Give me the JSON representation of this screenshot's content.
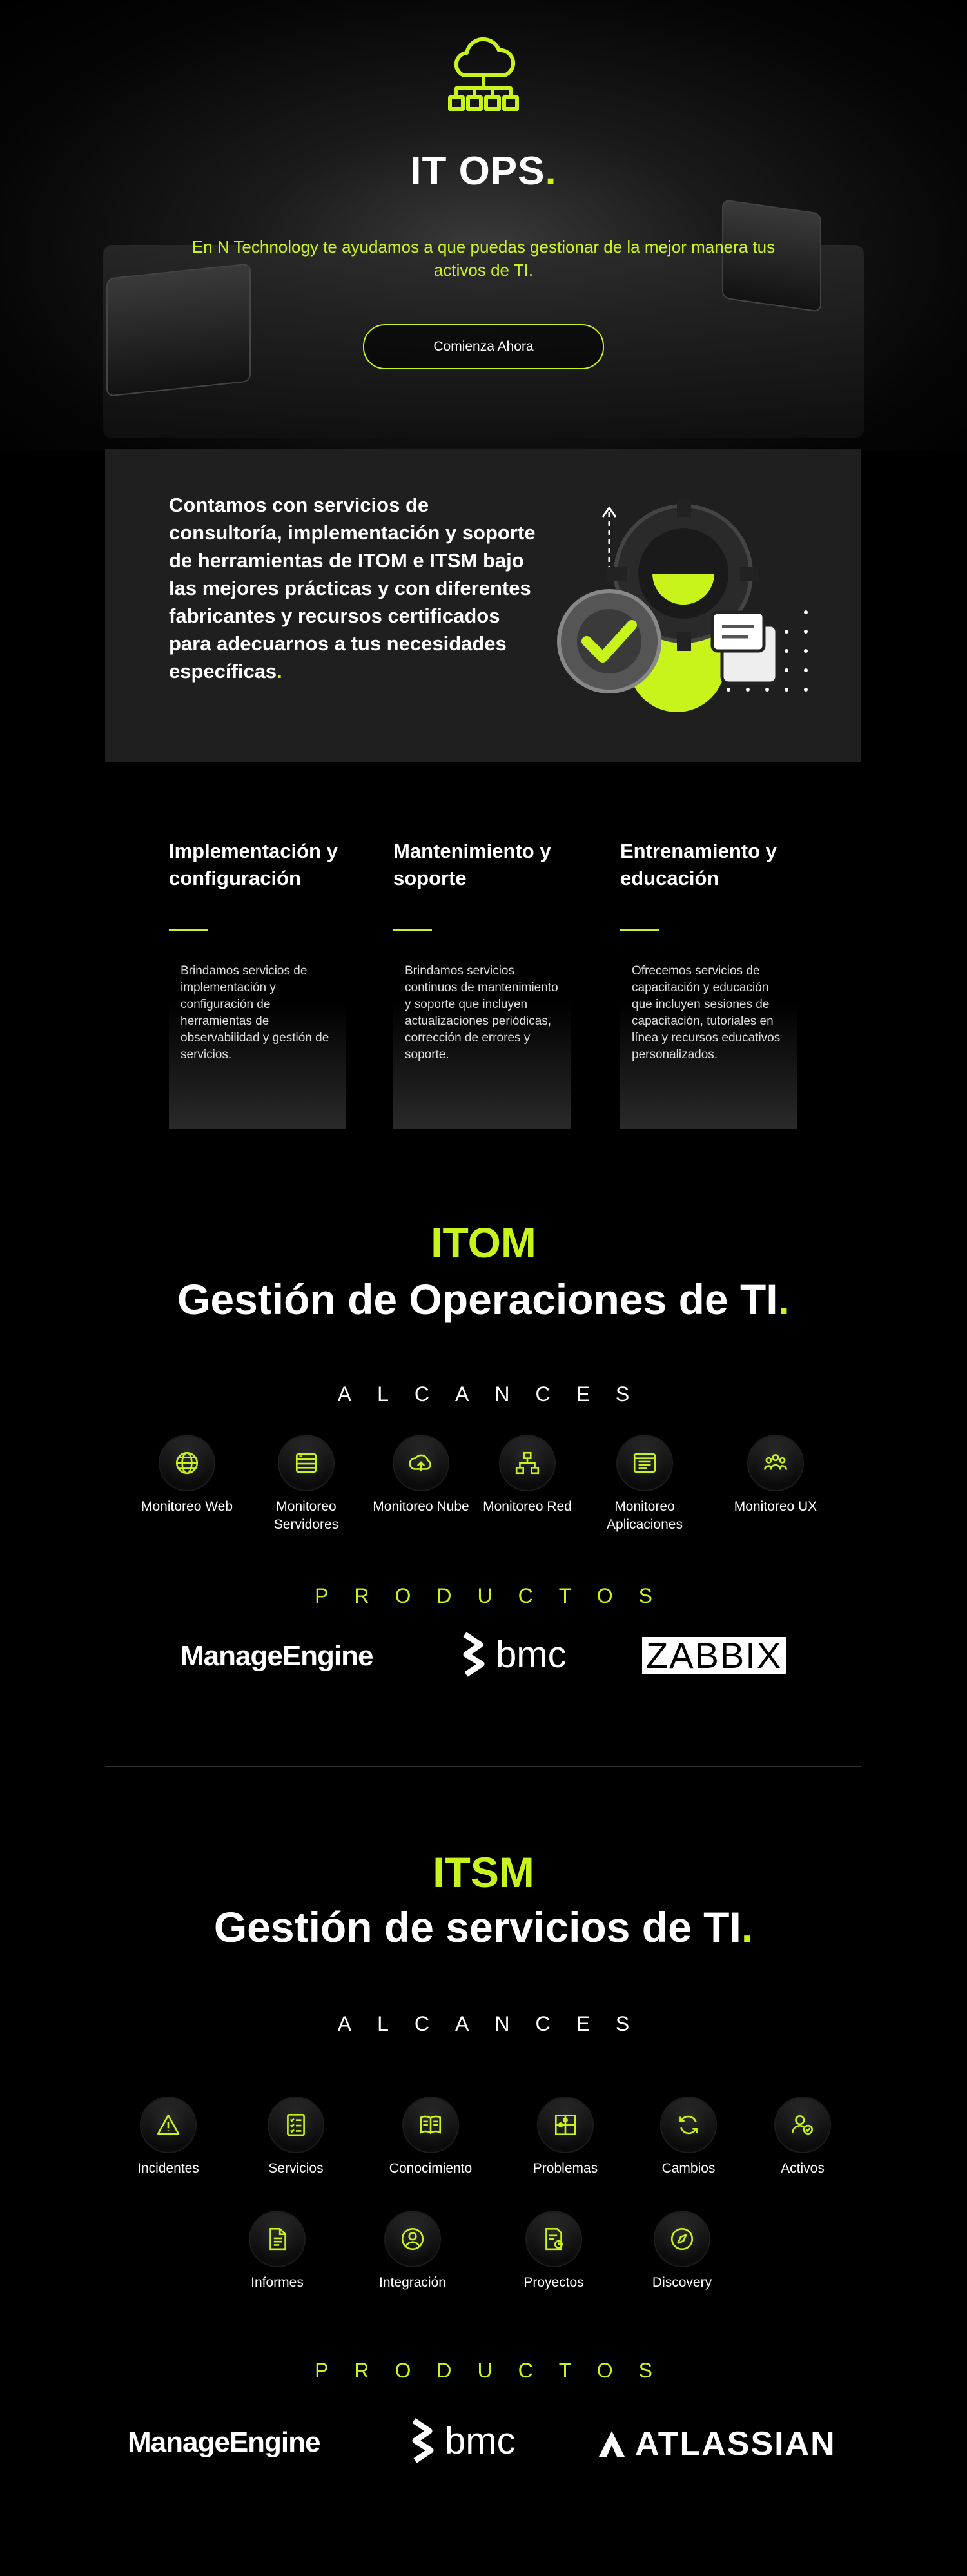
{
  "hero": {
    "title": "IT OPS",
    "title_dot": ".",
    "subtitle": "En N Technology te ayudamos a que puedas gestionar de la mejor manera tus activos de TI.",
    "cta_label": "Comienza Ahora",
    "icon": "cloud-network-icon"
  },
  "info": {
    "text": "Contamos con servicios de consultoría, implementación y soporte de herramientas de ITOM e ITSM bajo las mejores prácticas y con diferentes fabricantes y recursos certificados para adecuarnos a tus necesidades específicas",
    "dot": ".",
    "illustration": "gears-check-icon"
  },
  "services": [
    {
      "title": "Implementación y configuración",
      "text": "Brindamos servicios de implementación y configuración de herramientas de observabilidad y gestión de servicios."
    },
    {
      "title": "Mantenimiento y soporte",
      "text": "Brindamos servicios continuos de mantenimiento y soporte que incluyen actualizaciones periódicas, corrección de errores y soporte."
    },
    {
      "title": "Entrenamiento y educación",
      "text": "Ofrecemos servicios de capacitación y educación que incluyen sesiones de capacitación, tutoriales en línea y recursos educativos personalizados."
    }
  ],
  "itom": {
    "kicker": "ITOM",
    "title": "Gestión de Operaciones de TI",
    "dot": ".",
    "scope_label": "ALCANCES",
    "scope": [
      {
        "label": "Monitoreo Web",
        "icon": "globe-icon"
      },
      {
        "label": "Monitoreo Servidores",
        "icon": "server-icon"
      },
      {
        "label": "Monitoreo Nube",
        "icon": "cloud-upload-icon"
      },
      {
        "label": "Monitoreo Red",
        "icon": "network-icon"
      },
      {
        "label": "Monitoreo Aplicaciones",
        "icon": "app-window-icon"
      },
      {
        "label": "Monitoreo UX",
        "icon": "users-icon"
      }
    ],
    "products_label": "PRODUCTOS",
    "products": [
      "ManageEngine",
      "bmc",
      "ZABBIX"
    ]
  },
  "itsm": {
    "kicker": "ITSM",
    "title": "Gestión de servicios de TI",
    "dot": ".",
    "scope_label": "ALCANCES",
    "scope": [
      {
        "label": "Incidentes",
        "icon": "warning-icon"
      },
      {
        "label": "Servicios",
        "icon": "checklist-icon"
      },
      {
        "label": "Conocimiento",
        "icon": "book-icon"
      },
      {
        "label": "Problemas",
        "icon": "puzzle-icon"
      },
      {
        "label": "Cambios",
        "icon": "refresh-icon"
      },
      {
        "label": "Activos",
        "icon": "user-check-icon"
      },
      {
        "label": "Informes",
        "icon": "document-icon"
      },
      {
        "label": "Integración",
        "icon": "user-circle-icon"
      },
      {
        "label": "Proyectos",
        "icon": "project-icon"
      },
      {
        "label": "Discovery",
        "icon": "compass-icon"
      }
    ],
    "products_label": "PRODUCTOS",
    "products": [
      "ManageEngine",
      "bmc",
      "ATLASSIAN"
    ]
  },
  "colors": {
    "accent": "#c8f41c",
    "background": "#000000",
    "panel": "#1f1f1f"
  }
}
